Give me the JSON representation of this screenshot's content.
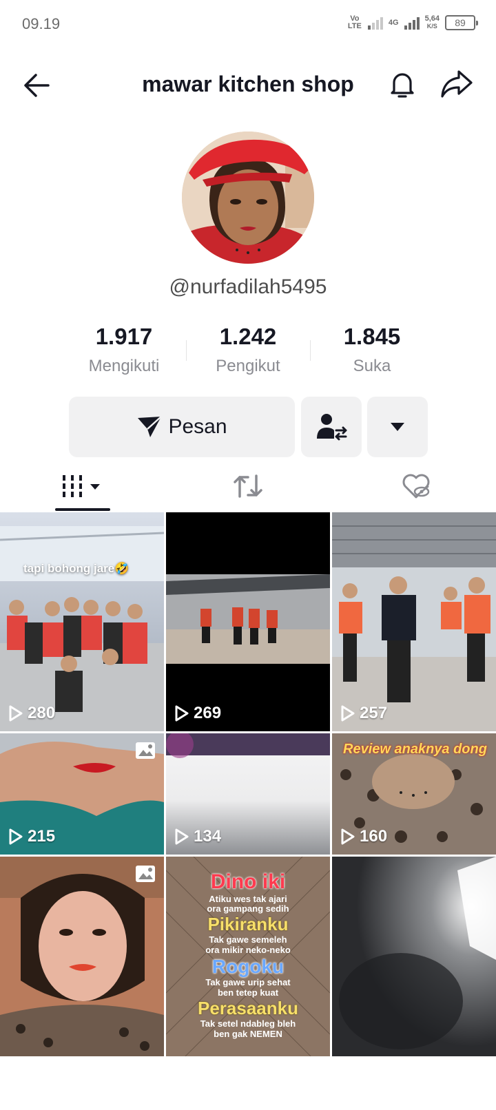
{
  "status": {
    "time": "09.19",
    "volte": "Vo LTE",
    "network": "4G",
    "speed_value": "5,64",
    "speed_unit": "K/S",
    "battery": "89"
  },
  "header": {
    "title": "mawar kitchen shop"
  },
  "profile": {
    "handle": "@nurfadilah5495"
  },
  "stats": [
    {
      "value": "1.917",
      "label": "Mengikuti"
    },
    {
      "value": "1.242",
      "label": "Pengikut"
    },
    {
      "value": "1.845",
      "label": "Suka"
    }
  ],
  "actions": {
    "message_label": "Pesan"
  },
  "videos": [
    {
      "views": "280",
      "caption": "tapi bohong jare🤣"
    },
    {
      "views": "269"
    },
    {
      "views": "257"
    },
    {
      "views": "215"
    },
    {
      "views": "134"
    },
    {
      "views": "160",
      "caption": "Review anaknya dong"
    },
    {
      "views": ""
    },
    {
      "views": "",
      "caption_lines": [
        "Dino iki",
        "Atiku wes tak ajari",
        "ora gampang sedih",
        "Pikiranku",
        "Tak gawe semeleh",
        "ora mikir neko-neko",
        "Rogoku",
        "Tak gawe urip sehat",
        "ben tetep kuat",
        "Perasaanku",
        "Tak setel ndableg bleh",
        "ben gak NEMEN"
      ]
    },
    {
      "views": ""
    }
  ]
}
